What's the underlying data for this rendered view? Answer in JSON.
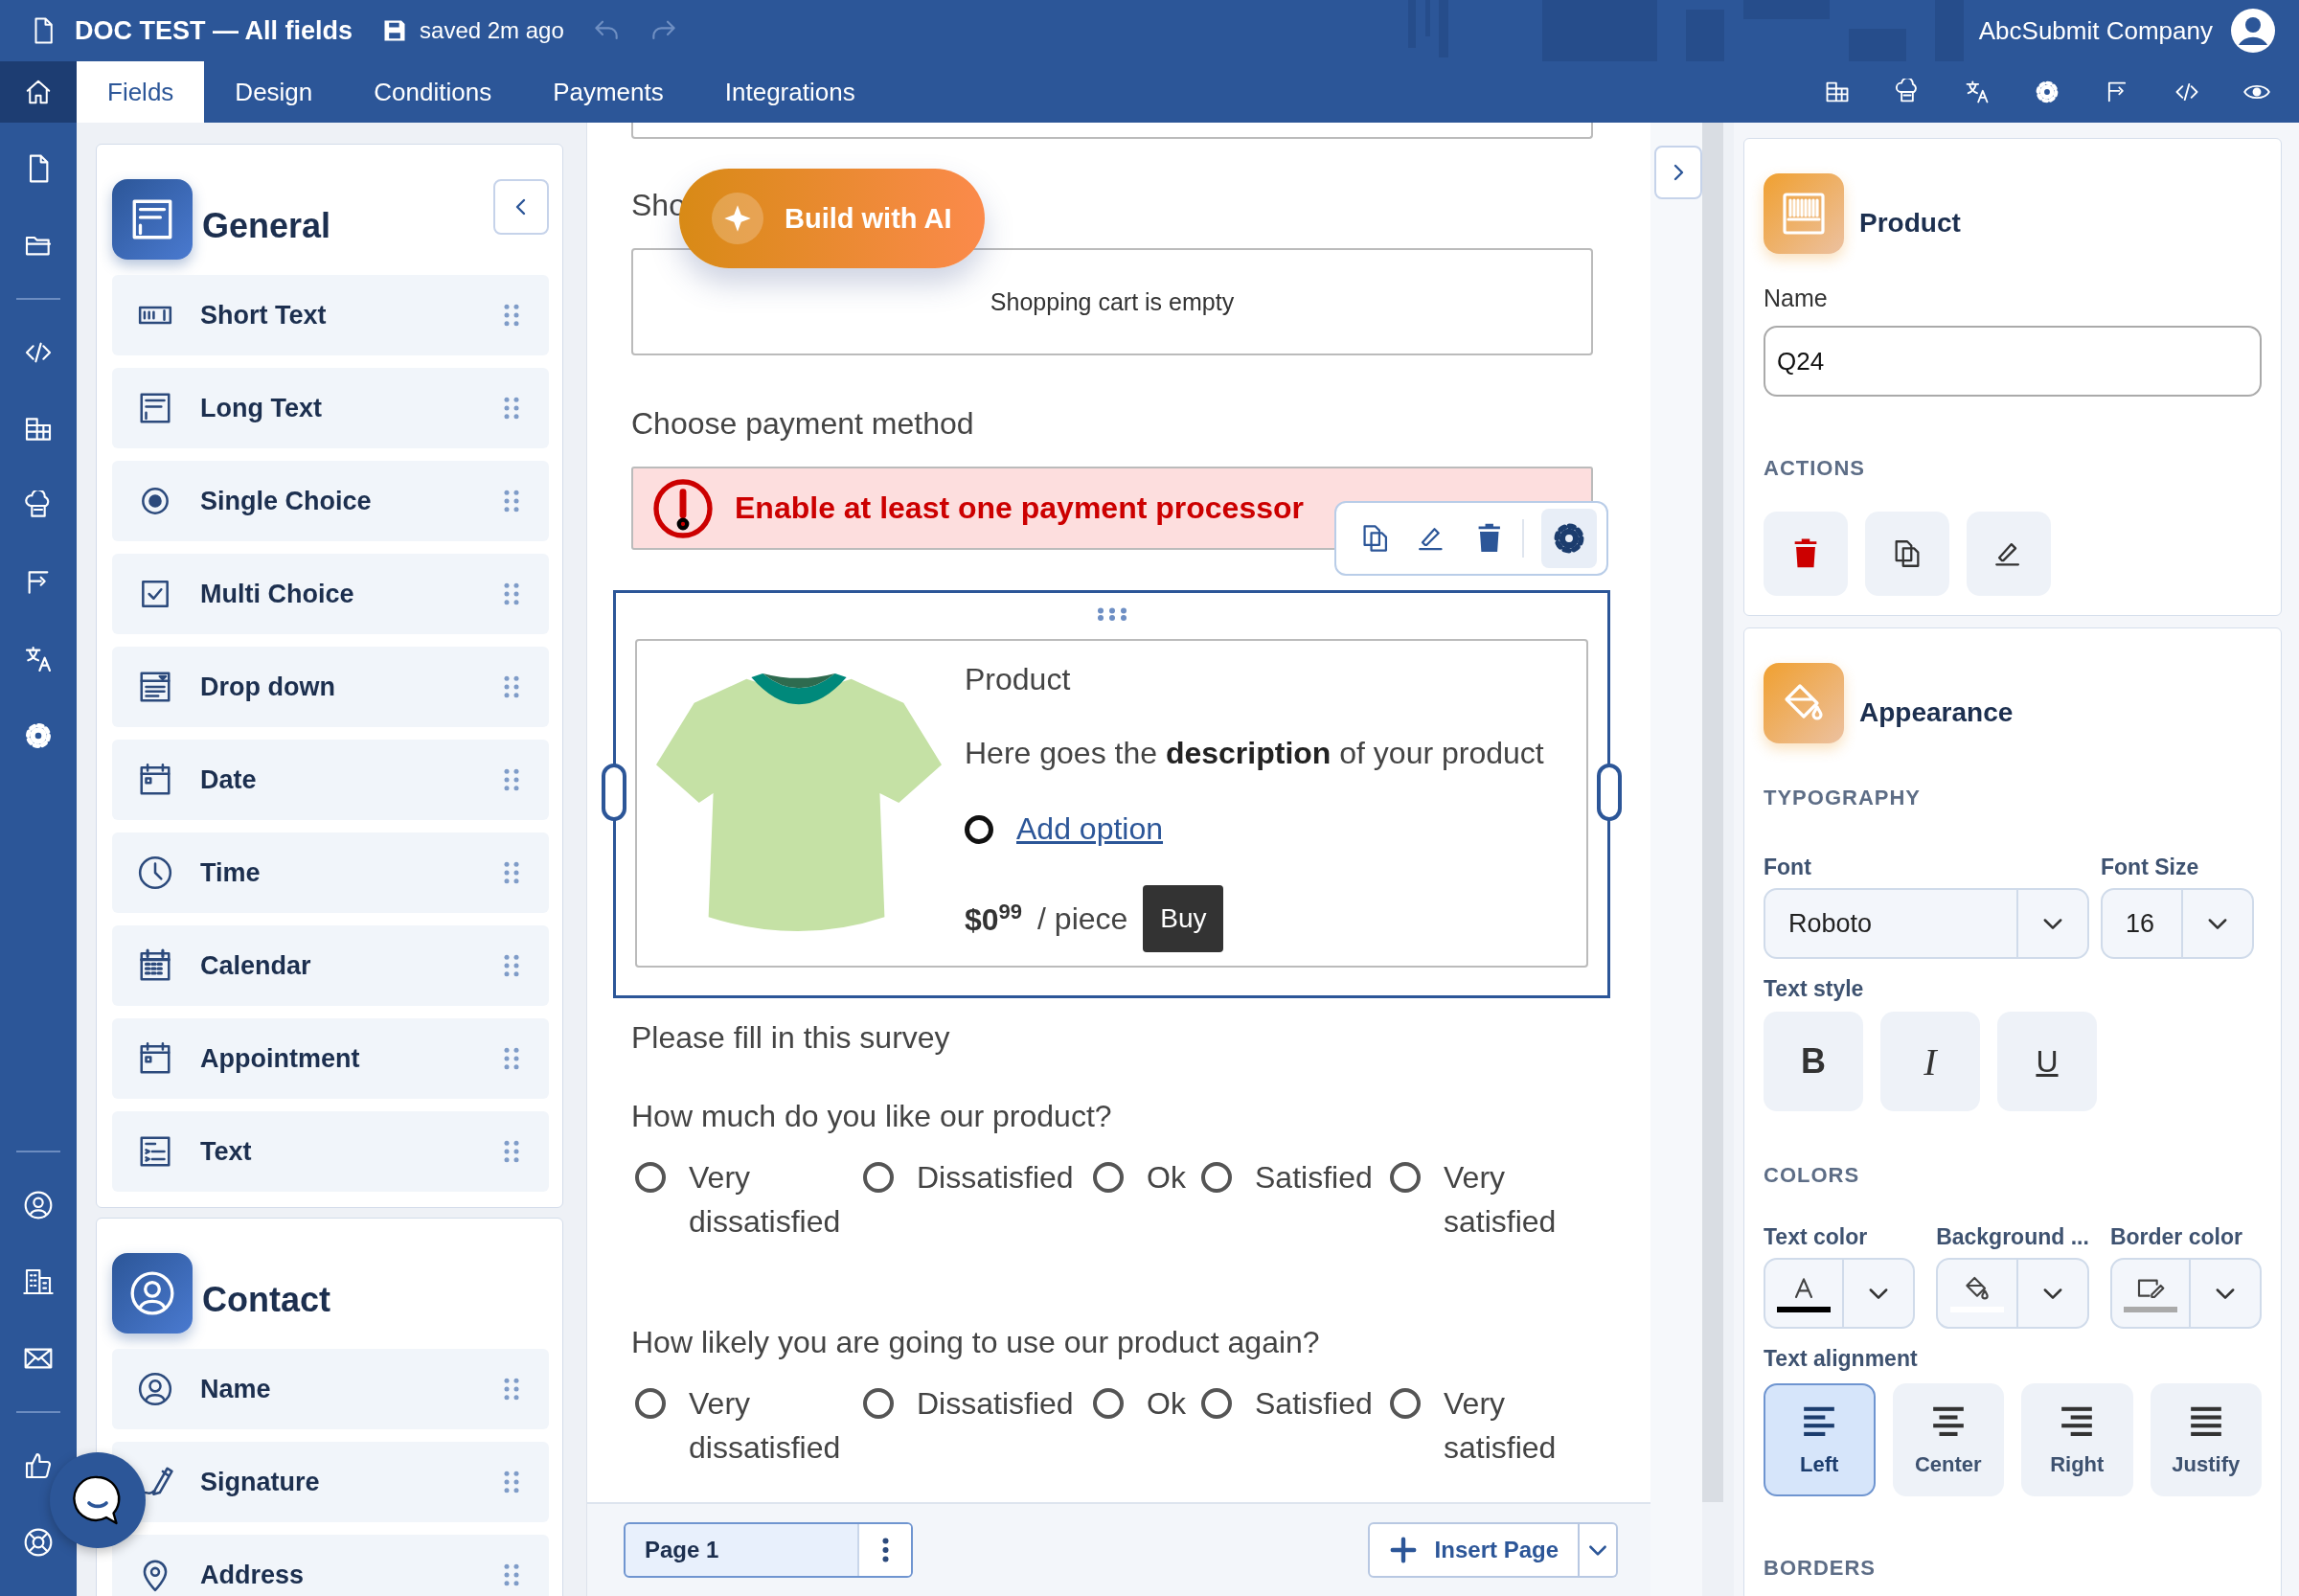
{
  "header": {
    "title": "DOC TEST — All fields",
    "save_status": "saved 2m ago",
    "account": "AbcSubmit Company"
  },
  "tabs": [
    {
      "label": "Fields",
      "selected": true
    },
    {
      "label": "Design",
      "selected": false
    },
    {
      "label": "Conditions",
      "selected": false
    },
    {
      "label": "Payments",
      "selected": false
    },
    {
      "label": "Integrations",
      "selected": false
    }
  ],
  "field_groups": [
    {
      "title": "General",
      "kind": "general",
      "items": [
        {
          "label": "Short Text",
          "kind": "short_text"
        },
        {
          "label": "Long Text",
          "kind": "long_text"
        },
        {
          "label": "Single Choice",
          "kind": "single_choice"
        },
        {
          "label": "Multi Choice",
          "kind": "multi_choice"
        },
        {
          "label": "Drop down",
          "kind": "dropdown"
        },
        {
          "label": "Date",
          "kind": "date"
        },
        {
          "label": "Time",
          "kind": "time"
        },
        {
          "label": "Calendar",
          "kind": "calendar"
        },
        {
          "label": "Appointment",
          "kind": "appointment"
        },
        {
          "label": "Text",
          "kind": "text"
        }
      ]
    },
    {
      "title": "Contact",
      "kind": "contact",
      "items": [
        {
          "label": "Name",
          "kind": "name"
        },
        {
          "label": "Signature",
          "kind": "signature"
        },
        {
          "label": "Address",
          "kind": "address"
        }
      ]
    }
  ],
  "ai_button": "Build with AI",
  "form": {
    "cut_label": "Sho",
    "cart_text": "Shopping cart is empty",
    "payment_label": "Choose payment method",
    "payment_error": "Enable at least one payment processor",
    "product": {
      "title": "Product",
      "description": "Here goes the **description** of your product",
      "option_link": "Add option",
      "price": "$0",
      "cents": "99",
      "unit": "/ piece",
      "buy": "Buy"
    },
    "survey_title": "Please fill in this survey",
    "questions": [
      {
        "text": "How much do you like our product?",
        "options": [
          {
            "label": "Very dissatisfied",
            "selected": false
          },
          {
            "label": "Dissatisfied",
            "selected": false
          },
          {
            "label": "Ok",
            "selected": false
          },
          {
            "label": "Satisfied",
            "selected": false
          },
          {
            "label": "Very satisfied",
            "selected": false
          }
        ]
      },
      {
        "text": "How likely you are going to use our product again?",
        "options": [
          {
            "label": "Very dissatisfied",
            "selected": false
          },
          {
            "label": "Dissatisfied",
            "selected": false
          },
          {
            "label": "Ok",
            "selected": false
          },
          {
            "label": "Satisfied",
            "selected": false
          },
          {
            "label": "Very satisfied",
            "selected": false
          }
        ]
      }
    ]
  },
  "page_bar": {
    "page": "Page 1",
    "insert": "Insert Page"
  },
  "properties": {
    "title": "Product",
    "name_label": "Name",
    "name_value": "Q24",
    "actions_heading": "ACTIONS"
  },
  "appearance": {
    "title": "Appearance",
    "typography_heading": "TYPOGRAPHY",
    "font_label": "Font",
    "font_value": "Roboto",
    "size_label": "Font Size",
    "size_value": "16",
    "style_label": "Text style",
    "styles": [
      {
        "label": "B",
        "kind": "bold"
      },
      {
        "label": "I",
        "kind": "italic"
      },
      {
        "label": "U",
        "kind": "underline"
      }
    ],
    "colors_heading": "COLORS",
    "colors": [
      {
        "label": "Text color",
        "kind": "text",
        "color": "#000000"
      },
      {
        "label": "Background ...",
        "kind": "background",
        "color": "#ffffff"
      },
      {
        "label": "Border color",
        "kind": "border",
        "color": "#aaaaaa"
      }
    ],
    "align_label": "Text alignment",
    "alignments": [
      {
        "label": "Left",
        "kind": "left",
        "selected": true
      },
      {
        "label": "Center",
        "kind": "center",
        "selected": false
      },
      {
        "label": "Right",
        "kind": "right",
        "selected": false
      },
      {
        "label": "Justify",
        "kind": "justify",
        "selected": false
      }
    ],
    "borders_heading": "BORDERS"
  }
}
